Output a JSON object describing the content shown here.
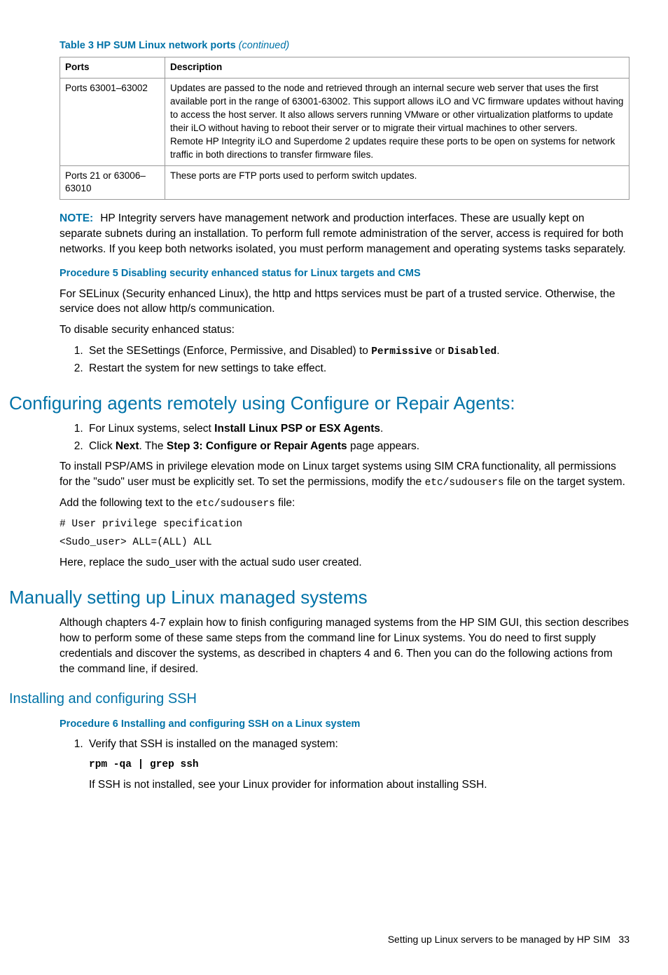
{
  "table": {
    "caption_prefix": "Table 3 HP SUM Linux network ports ",
    "continued": "(continued)",
    "headers": [
      "Ports",
      "Description"
    ],
    "rows": [
      {
        "ports": "Ports 63001–63002",
        "desc": "Updates are passed to the node and retrieved through an internal secure web server that uses the first available port in the range of 63001-63002. This support allows iLO and VC firmware updates without having to access the host server. It also allows servers running VMware or other virtualization platforms to update their iLO without having to reboot their server or to migrate their virtual machines to other servers.\nRemote HP Integrity iLO and Superdome 2 updates require these ports to be open on systems for network traffic in both directions to transfer firmware files."
      },
      {
        "ports": "Ports 21 or 63006–63010",
        "desc": "These ports are FTP ports used to perform switch updates."
      }
    ]
  },
  "note": {
    "label": "NOTE:",
    "text": "HP Integrity servers have management network and production interfaces. These are usually kept on separate subnets during an installation. To perform full remote administration of the server, access is required for both networks. If you keep both networks isolated, you must perform management and operating systems tasks separately."
  },
  "proc5": {
    "title": "Procedure 5 Disabling security enhanced status for Linux targets and CMS",
    "intro": "For SELinux (Security enhanced Linux), the http and https services must be part of a trusted service. Otherwise, the service does not allow http/s communication.",
    "lead": "To disable security enhanced status:",
    "step1_pre": "Set the SESettings (Enforce, Permissive, and Disabled) to ",
    "step1_opt1": "Permissive",
    "step1_or": " or ",
    "step1_opt2": "Disabled",
    "step1_end": ".",
    "step2": "Restart the system for new settings to take effect."
  },
  "sec_cfg": {
    "heading": "Configuring agents remotely using Configure or Repair Agents:",
    "step1_pre": "For Linux systems, select ",
    "step1_bold": "Install Linux PSP or ESX Agents",
    "step1_end": ".",
    "step2_pre": "Click ",
    "step2_b1": "Next",
    "step2_mid": ". The ",
    "step2_b2": "Step 3: Configure or Repair Agents",
    "step2_end": " page appears.",
    "p1_pre": "To install PSP/AMS in privilege elevation mode on Linux target systems using SIM CRA functionality, all permissions for the \"sudo\" user must be explicitly set. To set the permissions, modify the ",
    "p1_code": "etc/sudousers",
    "p1_end": " file on the target system.",
    "p2_pre": "Add the following text to the ",
    "p2_code": "etc/sudousers",
    "p2_end": " file:",
    "code1": "# User privilege specification",
    "code2": "<Sudo_user> ALL=(ALL) ALL",
    "p3": "Here, replace the sudo_user with the actual sudo user created."
  },
  "sec_manual": {
    "heading": "Manually setting up Linux managed systems",
    "p1": "Although chapters 4-7 explain how to finish configuring managed systems from the HP SIM GUI, this section describes how to perform some of these same steps from the command line for Linux systems. You do need to first supply credentials and discover the systems, as described in chapters 4 and 6. Then you can do the following actions from the command line, if desired."
  },
  "sec_ssh": {
    "heading": "Installing and configuring SSH",
    "proc_title": "Procedure 6 Installing and configuring SSH on a Linux system",
    "step1": "Verify that SSH is installed on the managed system:",
    "cmd": "rpm -qa | grep ssh",
    "after": "If SSH is not installed, see your Linux provider for information about installing SSH."
  },
  "footer": {
    "text": "Setting up Linux servers to be managed by HP SIM",
    "page": "33"
  }
}
